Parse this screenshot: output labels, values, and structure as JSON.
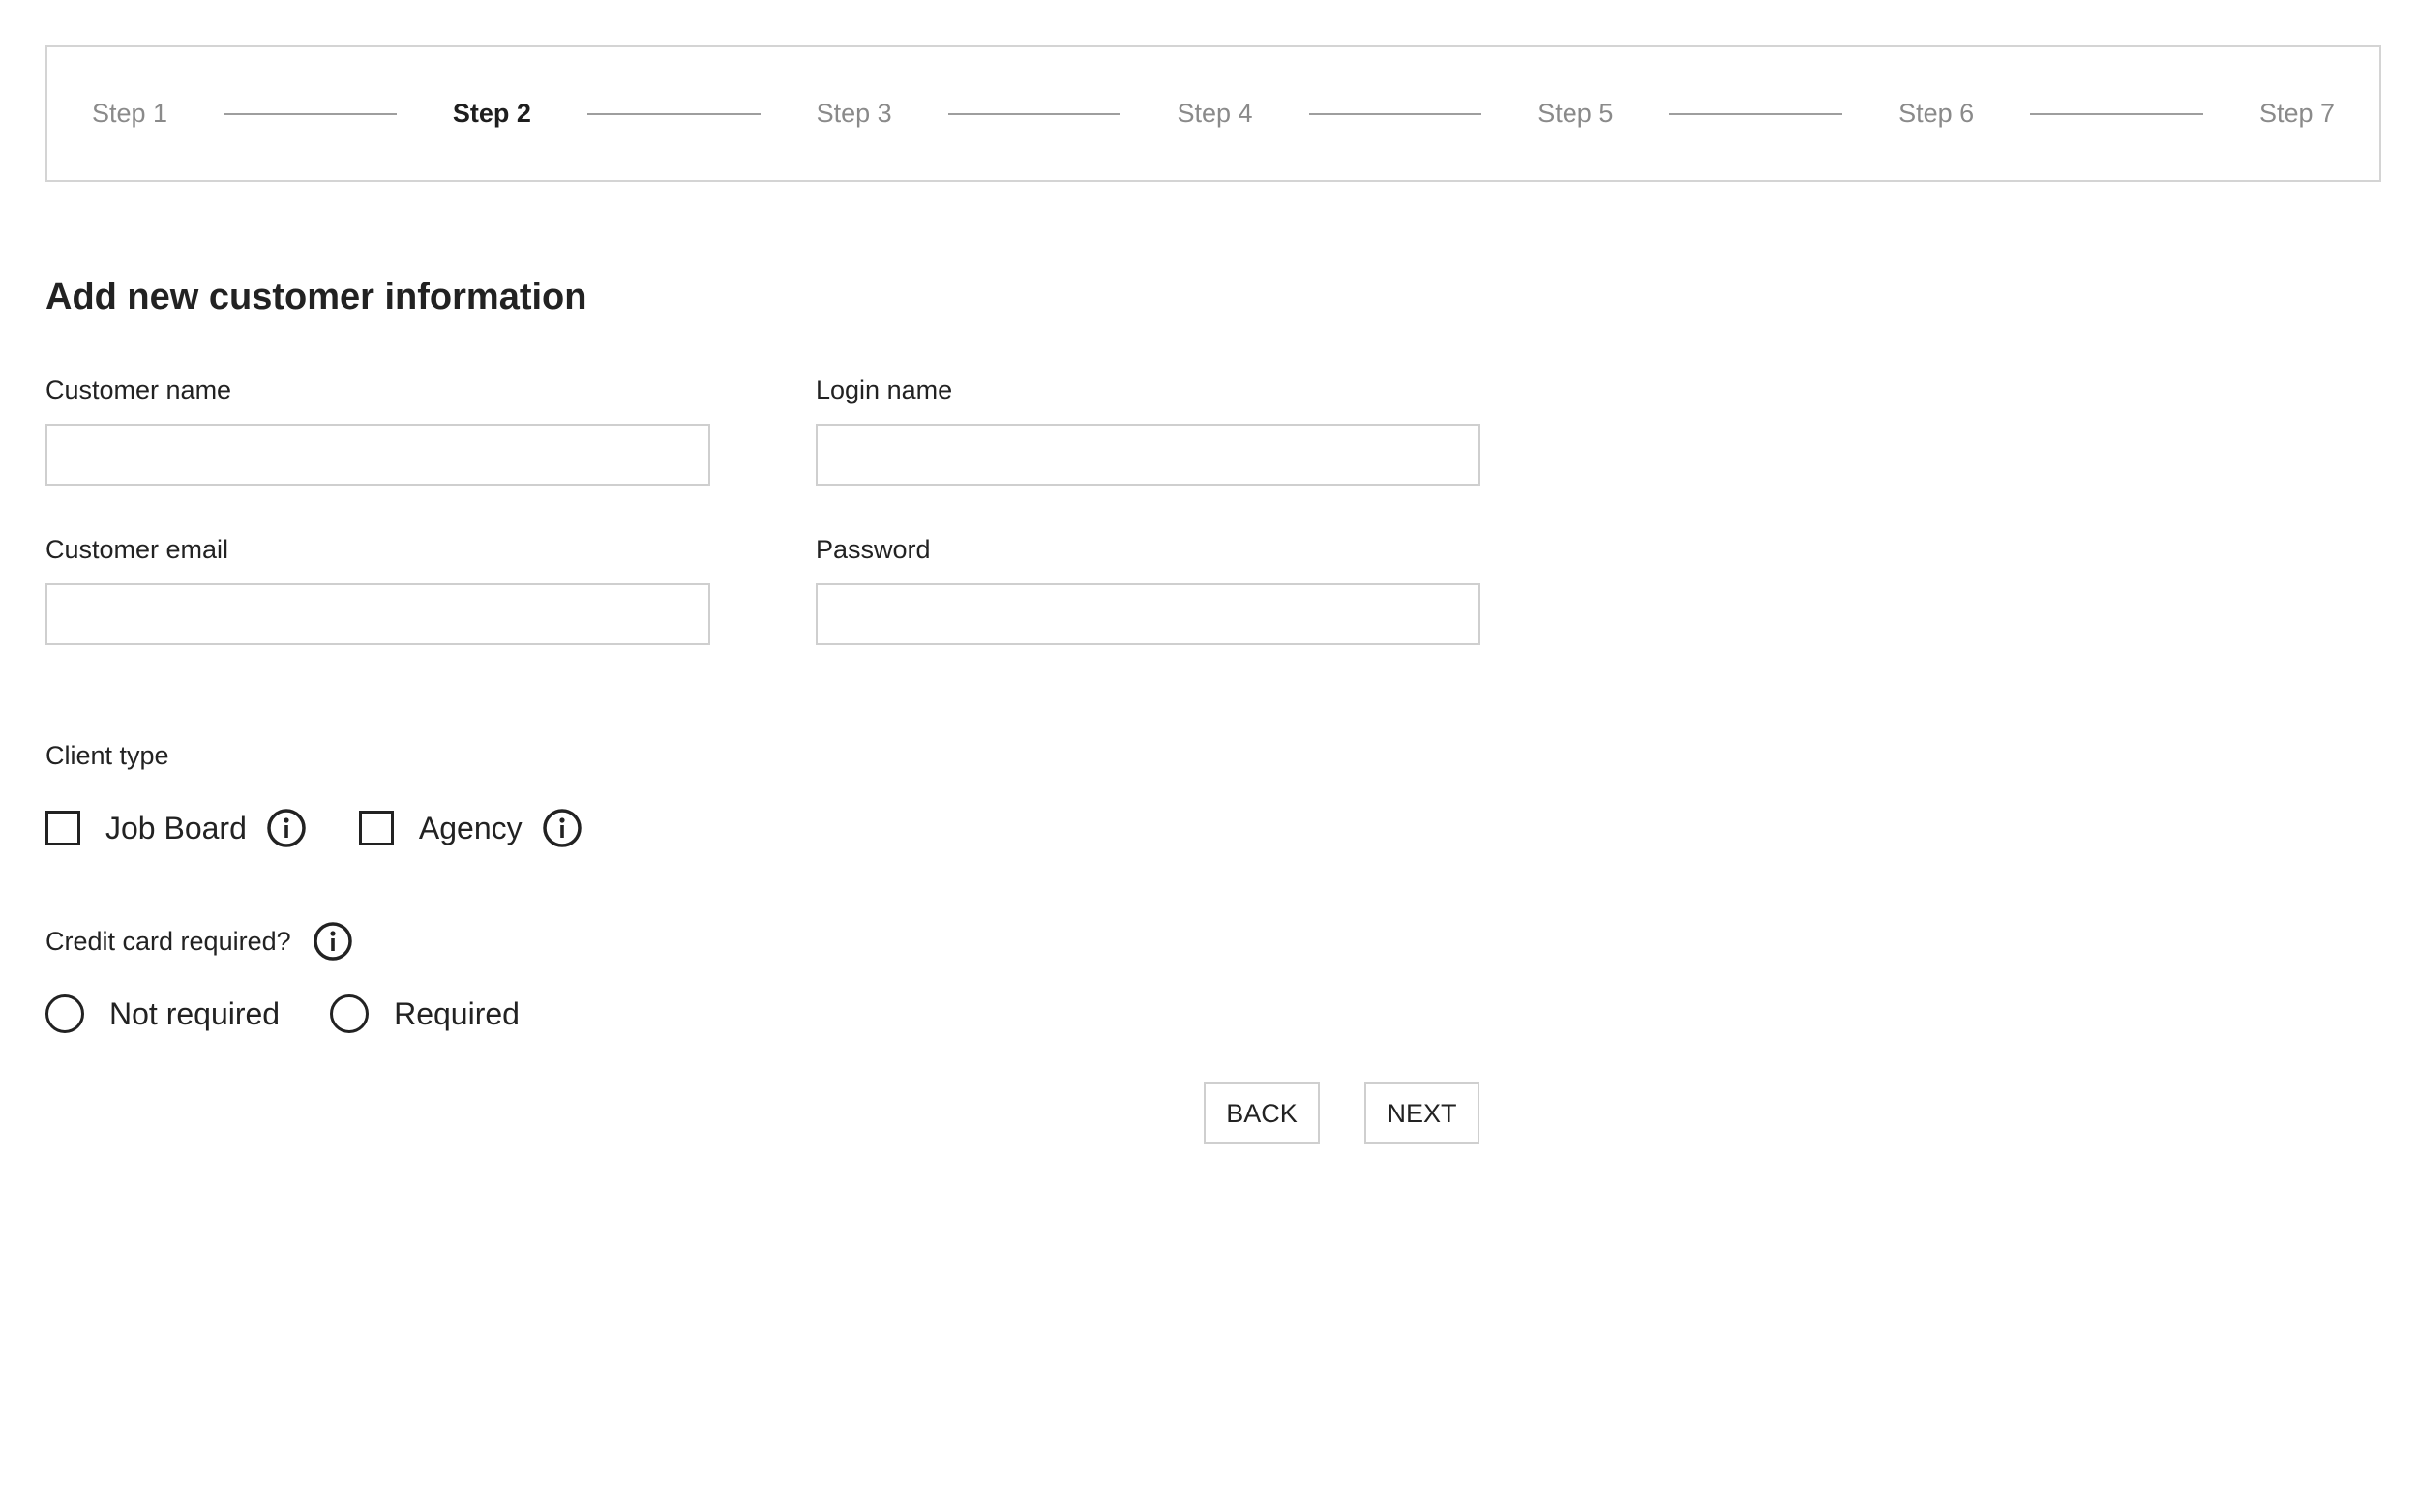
{
  "stepper": {
    "steps": [
      {
        "label": "Step 1",
        "active": false
      },
      {
        "label": "Step 2",
        "active": true
      },
      {
        "label": "Step 3",
        "active": false
      },
      {
        "label": "Step 4",
        "active": false
      },
      {
        "label": "Step 5",
        "active": false
      },
      {
        "label": "Step 6",
        "active": false
      },
      {
        "label": "Step 7",
        "active": false
      }
    ]
  },
  "form": {
    "title": "Add new customer information",
    "fields": {
      "customer_name": {
        "label": "Customer name",
        "value": "",
        "placeholder": ""
      },
      "login_name": {
        "label": "Login name",
        "value": "",
        "placeholder": ""
      },
      "customer_email": {
        "label": "Customer email",
        "value": "",
        "placeholder": ""
      },
      "password": {
        "label": "Password",
        "value": "",
        "placeholder": ""
      }
    },
    "client_type": {
      "label": "Client type",
      "options": [
        {
          "label": "Job Board",
          "checked": false,
          "icon": "info-icon"
        },
        {
          "label": "Agency",
          "checked": false,
          "icon": "info-icon"
        }
      ]
    },
    "credit_card": {
      "label": "Credit card required?",
      "icon": "info-icon",
      "options": [
        {
          "label": "Not required",
          "selected": false
        },
        {
          "label": "Required",
          "selected": false
        }
      ]
    },
    "buttons": {
      "back": "BACK",
      "next": "NEXT"
    }
  },
  "colors": {
    "border": "#cfcfcf",
    "text": "#222222",
    "muted": "#8a8a8a"
  }
}
